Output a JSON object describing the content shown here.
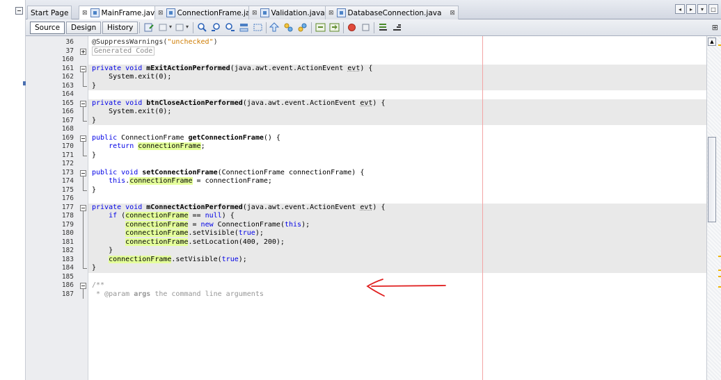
{
  "tabs": [
    {
      "label": "Start Page",
      "active": false,
      "icon": "none"
    },
    {
      "label": "MainFrame.java",
      "active": true,
      "icon": "form-file-icon"
    },
    {
      "label": "ConnectionFrame.java",
      "active": false,
      "icon": "form-file-icon"
    },
    {
      "label": "Validation.java",
      "active": false,
      "icon": "java-file-icon"
    },
    {
      "label": "DatabaseConnection.java",
      "active": false,
      "icon": "java-file-icon"
    }
  ],
  "toolbar": {
    "source_label": "Source",
    "design_label": "Design",
    "history_label": "History"
  },
  "colors": {
    "keyword": "#0000e6",
    "string": "#ce7b00",
    "highlight": "#e4ff9a",
    "margin_line": "#f3a4a4",
    "annotation_arrow": "#e02020"
  },
  "annotation": {
    "type": "hand-drawn-arrow",
    "color": "#e02020",
    "target_line": "179"
  },
  "lines": [
    {
      "num": "36",
      "tokens": [
        [
          "@SuppressWarnings(",
          "ann"
        ],
        [
          "\"unchecked\"",
          "str"
        ],
        [
          ")",
          "ann"
        ]
      ]
    },
    {
      "num": "37",
      "fold": "plus",
      "tokens": [
        [
          "Generated Code",
          "fold"
        ]
      ]
    },
    {
      "num": "160",
      "tokens": []
    },
    {
      "num": "161",
      "fold": "minus",
      "bg": true,
      "tokens": [
        [
          "private void ",
          "kw"
        ],
        [
          "mExitActionPerformed",
          "mn"
        ],
        [
          "(java.awt.event.ActionEvent ",
          ""
        ],
        [
          "evt",
          "ul"
        ],
        [
          ") {",
          ""
        ]
      ]
    },
    {
      "num": "162",
      "bg": true,
      "tokens": [
        [
          "    System.exit(0);",
          ""
        ]
      ]
    },
    {
      "num": "163",
      "fold": "end",
      "bg": true,
      "tokens": [
        [
          "}",
          ""
        ]
      ]
    },
    {
      "num": "164",
      "tokens": []
    },
    {
      "num": "165",
      "fold": "minus",
      "bg": true,
      "tokens": [
        [
          "private void ",
          "kw"
        ],
        [
          "btnCloseActionPerformed",
          "mn"
        ],
        [
          "(java.awt.event.ActionEvent ",
          ""
        ],
        [
          "evt",
          "ul"
        ],
        [
          ") {",
          ""
        ]
      ]
    },
    {
      "num": "166",
      "bg": true,
      "tokens": [
        [
          "    System.exit(0);",
          ""
        ]
      ]
    },
    {
      "num": "167",
      "fold": "end",
      "bg": true,
      "tokens": [
        [
          "}",
          ""
        ]
      ]
    },
    {
      "num": "168",
      "tokens": []
    },
    {
      "num": "169",
      "fold": "minus",
      "tokens": [
        [
          "public ",
          "kw"
        ],
        [
          "ConnectionFrame ",
          ""
        ],
        [
          "getConnectionFrame",
          "mn"
        ],
        [
          "() {",
          ""
        ]
      ]
    },
    {
      "num": "170",
      "tokens": [
        [
          "    ",
          ""
        ],
        [
          "return ",
          "kw"
        ],
        [
          "connectionFrame",
          "hl"
        ],
        [
          ";",
          ""
        ]
      ]
    },
    {
      "num": "171",
      "fold": "end",
      "tokens": [
        [
          "}",
          ""
        ]
      ]
    },
    {
      "num": "172",
      "tokens": []
    },
    {
      "num": "173",
      "fold": "minus",
      "tokens": [
        [
          "public void ",
          "kw"
        ],
        [
          "setConnectionFrame",
          "mn"
        ],
        [
          "(ConnectionFrame connectionFrame) {",
          ""
        ]
      ]
    },
    {
      "num": "174",
      "tokens": [
        [
          "    ",
          ""
        ],
        [
          "this",
          "kw"
        ],
        [
          ".",
          ""
        ],
        [
          "connectionFrame",
          "hl"
        ],
        [
          " = connectionFrame;",
          ""
        ]
      ]
    },
    {
      "num": "175",
      "fold": "end",
      "tokens": [
        [
          "}",
          ""
        ]
      ]
    },
    {
      "num": "176",
      "tokens": []
    },
    {
      "num": "177",
      "fold": "minus",
      "bg": true,
      "tokens": [
        [
          "private void ",
          "kw"
        ],
        [
          "mConnectActionPerformed",
          "mn"
        ],
        [
          "(java.awt.event.ActionEvent ",
          ""
        ],
        [
          "evt",
          "ul"
        ],
        [
          ") {",
          ""
        ]
      ]
    },
    {
      "num": "178",
      "bg": true,
      "tokens": [
        [
          "    ",
          ""
        ],
        [
          "if ",
          "kw"
        ],
        [
          "(",
          ""
        ],
        [
          "connectionFrame",
          "hl"
        ],
        [
          " == ",
          ""
        ],
        [
          "null",
          "kw"
        ],
        [
          ") {",
          ""
        ]
      ]
    },
    {
      "num": "179",
      "bg": true,
      "tokens": [
        [
          "        ",
          ""
        ],
        [
          "connectionFrame",
          "hl"
        ],
        [
          " = ",
          ""
        ],
        [
          "new ",
          "kw"
        ],
        [
          "ConnectionFrame(",
          ""
        ],
        [
          "this",
          "kw"
        ],
        [
          ");",
          ""
        ]
      ]
    },
    {
      "num": "180",
      "bg": true,
      "tokens": [
        [
          "        ",
          ""
        ],
        [
          "connectionFrame",
          "hl"
        ],
        [
          ".setVisible(",
          ""
        ],
        [
          "true",
          "kw"
        ],
        [
          ");",
          ""
        ]
      ]
    },
    {
      "num": "181",
      "bg": true,
      "tokens": [
        [
          "        ",
          ""
        ],
        [
          "connectionFrame",
          "hl"
        ],
        [
          ".setLocation(400, 200);",
          ""
        ]
      ]
    },
    {
      "num": "182",
      "bg": true,
      "tokens": [
        [
          "    }",
          ""
        ]
      ]
    },
    {
      "num": "183",
      "bg": true,
      "tokens": [
        [
          "    ",
          ""
        ],
        [
          "connectionFrame",
          "hl"
        ],
        [
          ".setVisible(",
          ""
        ],
        [
          "true",
          "kw"
        ],
        [
          ");",
          ""
        ]
      ]
    },
    {
      "num": "184",
      "fold": "end",
      "bg": true,
      "tokens": [
        [
          "}",
          ""
        ]
      ]
    },
    {
      "num": "185",
      "tokens": []
    },
    {
      "num": "186",
      "fold": "minus",
      "tokens": [
        [
          "/**",
          "cm"
        ]
      ]
    },
    {
      "num": "187",
      "tokens": [
        [
          " * @param ",
          "cm"
        ],
        [
          "args",
          "cm mn"
        ],
        [
          " the command line arguments",
          "cm"
        ]
      ]
    }
  ]
}
